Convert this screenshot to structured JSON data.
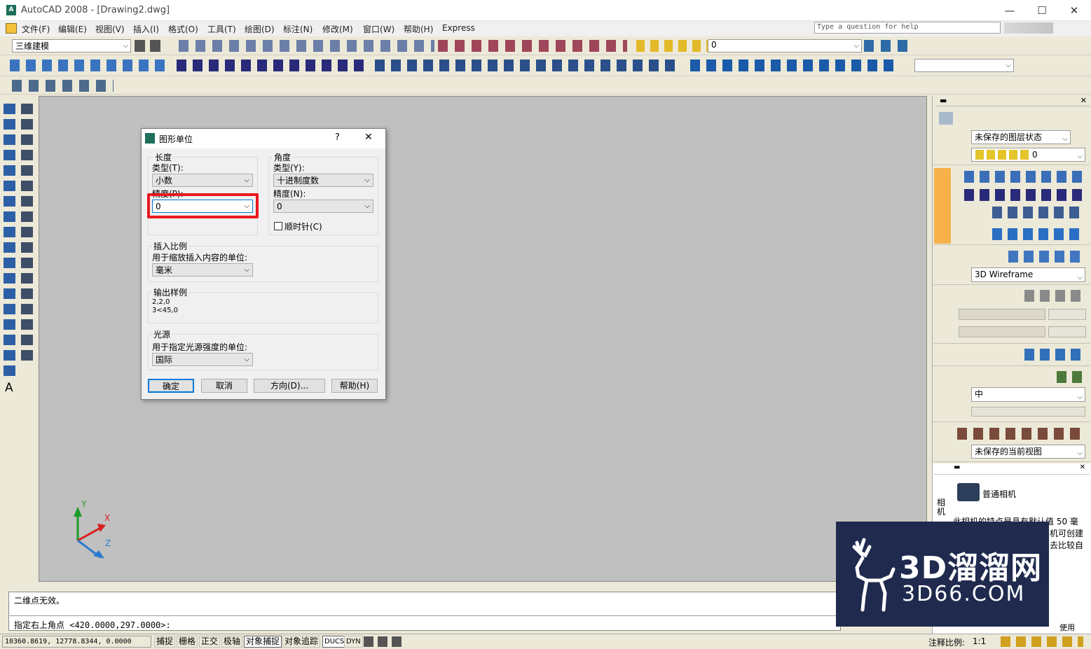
{
  "window": {
    "title": "AutoCAD 2008 - [Drawing2.dwg]",
    "min": "—",
    "max": "☐",
    "close": "✕"
  },
  "menu": [
    "文件(F)",
    "编辑(E)",
    "视图(V)",
    "插入(I)",
    "格式(O)",
    "工具(T)",
    "绘图(D)",
    "标注(N)",
    "修改(M)",
    "窗口(W)",
    "帮助(H)",
    "Express"
  ],
  "help_placeholder": "Type a question for help",
  "workspace_combo": "三维建模",
  "layer_combo": "0",
  "dialog": {
    "title": "图形单位",
    "help_glyph": "?",
    "close_glyph": "✕",
    "length": {
      "group": "长度",
      "type_label": "类型(T):",
      "type_value": "小数",
      "precision_label": "精度(P):",
      "precision_value": "0"
    },
    "angle": {
      "group": "角度",
      "type_label": "类型(Y):",
      "type_value": "十进制度数",
      "precision_label": "精度(N):",
      "precision_value": "0",
      "clockwise": "顺时针(C)"
    },
    "insert": {
      "group": "插入比例",
      "label": "用于缩放插入内容的单位:",
      "value": "毫米"
    },
    "sample": {
      "group": "输出样例",
      "line1": "2,2,0",
      "line2": "3<45,0"
    },
    "light": {
      "group": "光源",
      "label": "用于指定光源强度的单位:",
      "value": "国际"
    },
    "buttons": {
      "ok": "确定",
      "cancel": "取消",
      "direction": "方向(D)...",
      "help": "帮助(H)"
    }
  },
  "right_panel": {
    "layer_state": "未保存的图层状态",
    "layer_row": "0",
    "visual_style": "3D Wireframe",
    "material_combo": "中",
    "view_combo": "未保存的当前视图",
    "camera_title": "普通相机",
    "camera_side_label": "相机",
    "camera_desc": "此相机的特点是具有默认值 50 毫",
    "camera_desc2": "机可创建",
    "camera_desc3": "去比较自",
    "camera_footer": "使用"
  },
  "command": {
    "line1": "二维点无效。",
    "line2": "指定右上角点 <420.0000,297.0000>:"
  },
  "status": {
    "coords": "10360.8619, 12778.8344, 0.0000",
    "buttons": [
      "捕捉",
      "栅格",
      "正交",
      "极轴",
      "对象捕捉",
      "对象追踪",
      "DUCS",
      "DYN"
    ],
    "annotation_scale_label": "注释比例:",
    "annotation_scale": "1:1"
  },
  "ucs": {
    "x": "X",
    "y": "Y",
    "z": "Z"
  },
  "watermark": {
    "text": "3D溜溜网",
    "sub": "3D66.COM"
  },
  "colors": {
    "highlight": "#e8191f",
    "canvas": "#c0c0c0",
    "watermark_bg": "#1f2a4e",
    "panel_accent": "#f7b14a"
  }
}
